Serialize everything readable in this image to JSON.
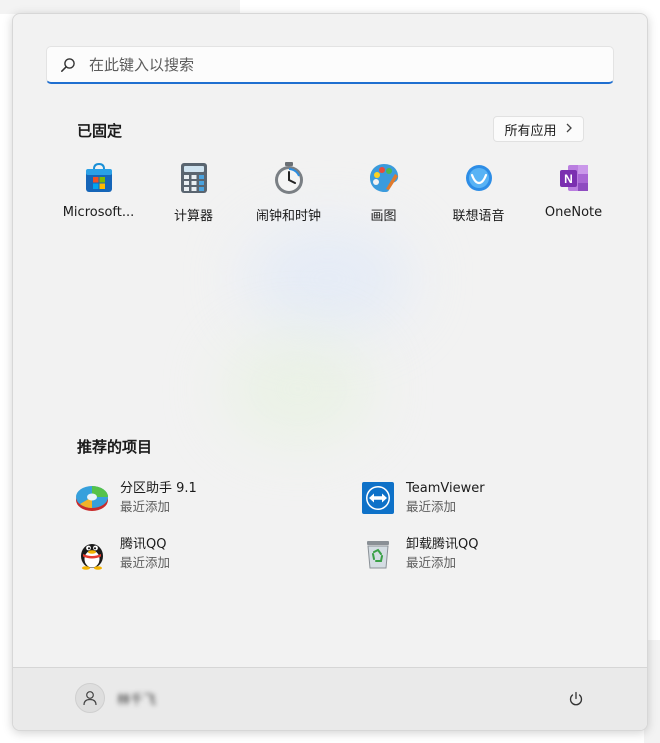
{
  "search": {
    "placeholder": "在此键入以搜索"
  },
  "pinned": {
    "title": "已固定",
    "all_apps_label": "所有应用",
    "apps": [
      {
        "label": "Microsoft...",
        "icon": "microsoft-store-icon"
      },
      {
        "label": "计算器",
        "icon": "calculator-icon"
      },
      {
        "label": "闹钟和时钟",
        "icon": "alarm-clock-icon"
      },
      {
        "label": "画图",
        "icon": "paint-palette-icon"
      },
      {
        "label": "联想语音",
        "icon": "lenovo-voice-icon"
      },
      {
        "label": "OneNote",
        "icon": "onenote-icon"
      }
    ]
  },
  "recommended": {
    "title": "推荐的项目",
    "items": [
      {
        "name": "分区助手 9.1",
        "sub": "最近添加",
        "icon": "partition-assistant-icon"
      },
      {
        "name": "TeamViewer",
        "sub": "最近添加",
        "icon": "teamviewer-icon"
      },
      {
        "name": "腾讯QQ",
        "sub": "最近添加",
        "icon": "qq-penguin-icon"
      },
      {
        "name": "卸载腾讯QQ",
        "sub": "最近添加",
        "icon": "recycle-bin-icon"
      }
    ]
  },
  "footer": {
    "user_name": "林千飞"
  },
  "colors": {
    "accent": "#1f6fd0",
    "menu_bg": "#f2f2f2",
    "footer_bg": "#eaeaea"
  }
}
